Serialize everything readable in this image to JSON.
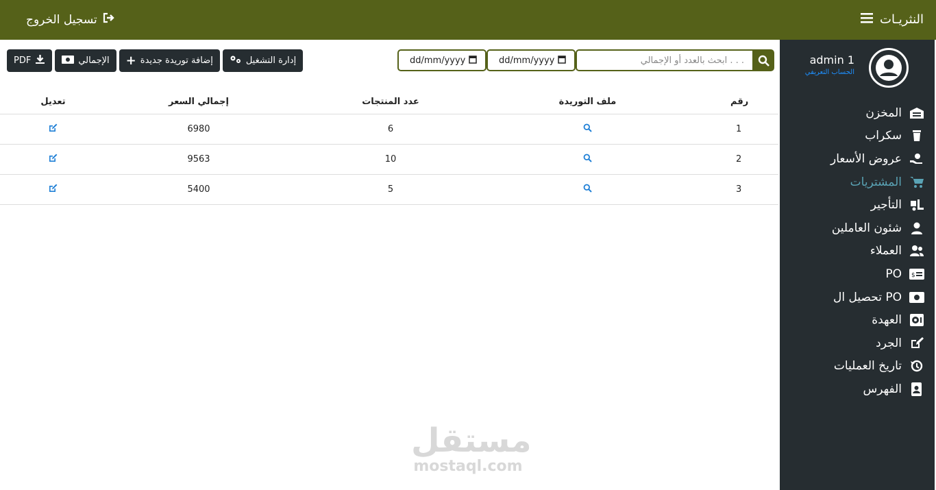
{
  "topbar": {
    "brand": "النثريـات",
    "logout": "تسجيل الخروج"
  },
  "profile": {
    "name": "admin 1",
    "link": "الحساب التعريفي"
  },
  "menu": [
    {
      "label": "المخزن",
      "icon": "warehouse-icon"
    },
    {
      "label": "سكراب",
      "icon": "trash-icon"
    },
    {
      "label": "عروض الأسعار",
      "icon": "hand-holding-dollar-icon"
    },
    {
      "label": "المشتريات",
      "icon": "cart-icon",
      "active": true
    },
    {
      "label": "التأجير",
      "icon": "truck-loading-icon"
    },
    {
      "label": "شئون العاملين",
      "icon": "user-icon"
    },
    {
      "label": "العملاء",
      "icon": "users-icon"
    },
    {
      "label": "PO",
      "icon": "money-check-icon"
    },
    {
      "label": "تحصيل ال PO",
      "icon": "money-bill-icon"
    },
    {
      "label": "العهدة",
      "icon": "vault-icon"
    },
    {
      "label": "الجرد",
      "icon": "edit-icon"
    },
    {
      "label": "تاريخ العمليات",
      "icon": "history-icon"
    },
    {
      "label": "الفهرس",
      "icon": "address-book-icon"
    }
  ],
  "filters": {
    "search_placeholder": "ابحث بالعدد أو الإجمالي . . .",
    "date_from": "dd/mm/yyyy",
    "date_to": "dd/mm/yyyy"
  },
  "toolbar": {
    "operations": "إدارة التشغيل",
    "add": "إضافة توريدة جديدة",
    "total": "الإجمالي",
    "pdf": "PDF"
  },
  "table": {
    "headers": {
      "num": "رقم",
      "file": "ملف التوريدة",
      "count": "عدد المنتجات",
      "total": "إجمالي السعر",
      "edit": "تعديل"
    },
    "rows": [
      {
        "num": "1",
        "count": "6",
        "total": "6980"
      },
      {
        "num": "2",
        "count": "10",
        "total": "9563"
      },
      {
        "num": "3",
        "count": "5",
        "total": "5400"
      }
    ]
  },
  "watermark": {
    "ar": "مستقل",
    "en": "mostaql.com"
  },
  "colors": {
    "topbar": "#556119",
    "sidebar": "#262d31",
    "link": "#1e7fd6",
    "active": "#5aa3b5"
  }
}
